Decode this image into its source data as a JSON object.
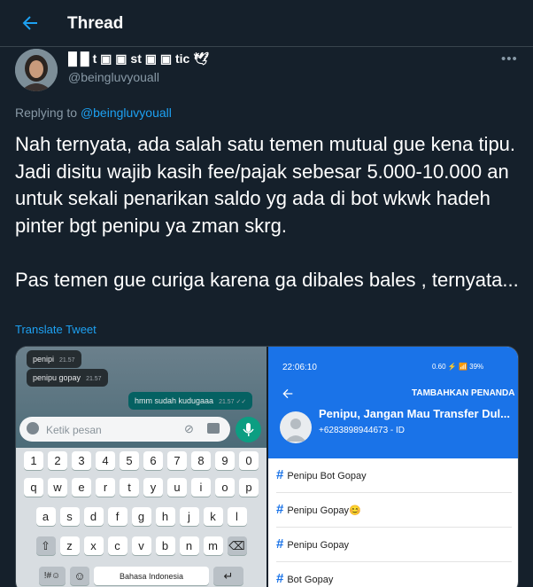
{
  "header": {
    "title": "Thread"
  },
  "author": {
    "display_name": "█ █ t ▣ ▣ st ▣ ▣ tic 🕊",
    "handle": "@beingluvyouall"
  },
  "reply": {
    "prefix": "Replying to ",
    "handle": "@beingluvyouall"
  },
  "tweet": {
    "text": "Nah ternyata, ada salah satu temen mutual gue kena tipu. Jadi disitu wajib kasih fee/pajak sebesar 5.000-10.000 an untuk sekali penarikan saldo yg ada di bot wkwk hadeh pinter bgt penipu ya zman skrg.\n\nPas temen gue curiga karena ga dibales bales , ternyata...",
    "translate_label": "Translate Tweet"
  },
  "whatsapp": {
    "messages": [
      {
        "text": "penipi",
        "time": "21.57",
        "dir": "in"
      },
      {
        "text": "penipu gopay",
        "time": "21.57",
        "dir": "in"
      },
      {
        "text": "hmm sudah kudugaaa",
        "time": "21.57 ✓✓",
        "dir": "out"
      }
    ],
    "input_placeholder": "Ketik pesan",
    "keyboard": {
      "row1": [
        "1",
        "2",
        "3",
        "4",
        "5",
        "6",
        "7",
        "8",
        "9",
        "0"
      ],
      "row2": [
        "q",
        "w",
        "e",
        "r",
        "t",
        "y",
        "u",
        "i",
        "o",
        "p"
      ],
      "row3": [
        "a",
        "s",
        "d",
        "f",
        "g",
        "h",
        "j",
        "k",
        "l"
      ],
      "row4": [
        "⇧",
        "z",
        "x",
        "c",
        "v",
        "b",
        "n",
        "m",
        "⌫"
      ],
      "row5": [
        "!#☺",
        "☺",
        "Bahasa Indonesia",
        "↵"
      ]
    }
  },
  "contact": {
    "time": "22:06:10",
    "status_icons": "0.60 ⚡ 📶 39%",
    "title": "TAMBAHKAN PENANDA",
    "name": "Penipu, Jangan Mau Transfer Dul...",
    "phone": "+6283898944673 - ID",
    "tags": [
      "Penipu Bot Gopay",
      "Penipu Gopay😊",
      "Penipu Gopay",
      "Bot Gopay"
    ]
  },
  "colors": {
    "background": "#15202b",
    "accent": "#1da1f2",
    "secondary_text": "#8899a6"
  }
}
